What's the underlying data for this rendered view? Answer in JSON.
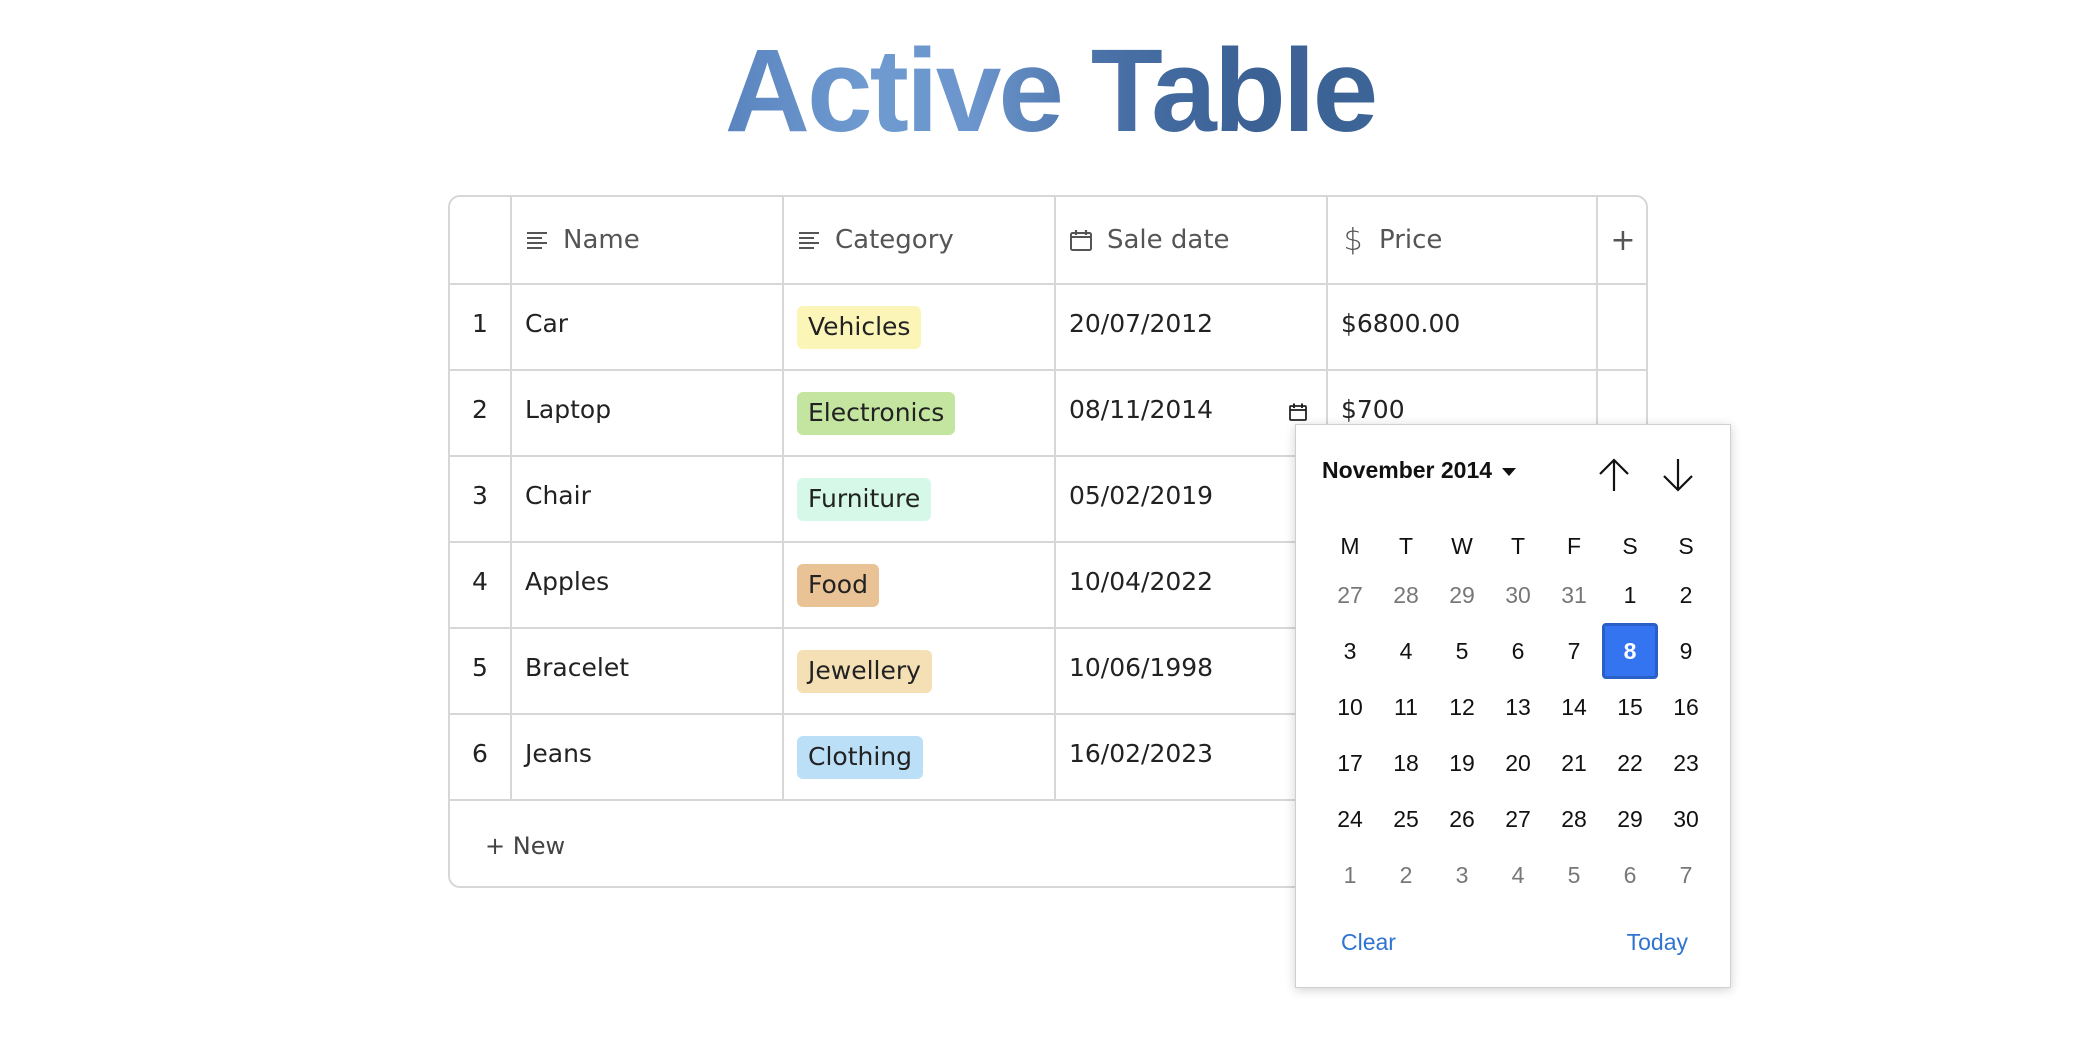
{
  "title": "Active Table",
  "table": {
    "columns": [
      {
        "label": "Name",
        "icon": "text-lines-icon"
      },
      {
        "label": "Category",
        "icon": "text-lines-icon"
      },
      {
        "label": "Sale date",
        "icon": "calendar-icon"
      },
      {
        "label": "Price",
        "icon": "dollar-icon"
      }
    ],
    "add_column_label": "+",
    "rows": [
      {
        "index": "1",
        "name": "Car",
        "category": "Vehicles",
        "category_color": "#fbf5b8",
        "sale_date": "20/07/2012",
        "price": "$6800.00"
      },
      {
        "index": "2",
        "name": "Laptop",
        "category": "Electronics",
        "category_color": "#c4e5a0",
        "sale_date": "08/11/2014",
        "price": "$700"
      },
      {
        "index": "3",
        "name": "Chair",
        "category": "Furniture",
        "category_color": "#d6f8e8",
        "sale_date": "05/02/2019",
        "price": ""
      },
      {
        "index": "4",
        "name": "Apples",
        "category": "Food",
        "category_color": "#e9c396",
        "sale_date": "10/04/2022",
        "price": ""
      },
      {
        "index": "5",
        "name": "Bracelet",
        "category": "Jewellery",
        "category_color": "#f4e0b4",
        "sale_date": "10/06/1998",
        "price": ""
      },
      {
        "index": "6",
        "name": "Jeans",
        "category": "Clothing",
        "category_color": "#bcdff8",
        "sale_date": "16/02/2023",
        "price": ""
      }
    ],
    "new_row_label": "+ New"
  },
  "datepicker": {
    "month_year": "November 2014",
    "prev_icon": "arrow-up-icon",
    "next_icon": "arrow-down-icon",
    "weekdays": [
      "M",
      "T",
      "W",
      "T",
      "F",
      "S",
      "S"
    ],
    "days": [
      {
        "d": "27",
        "other": true
      },
      {
        "d": "28",
        "other": true
      },
      {
        "d": "29",
        "other": true
      },
      {
        "d": "30",
        "other": true
      },
      {
        "d": "31",
        "other": true
      },
      {
        "d": "1"
      },
      {
        "d": "2"
      },
      {
        "d": "3"
      },
      {
        "d": "4"
      },
      {
        "d": "5"
      },
      {
        "d": "6"
      },
      {
        "d": "7"
      },
      {
        "d": "8",
        "selected": true
      },
      {
        "d": "9"
      },
      {
        "d": "10"
      },
      {
        "d": "11"
      },
      {
        "d": "12"
      },
      {
        "d": "13"
      },
      {
        "d": "14"
      },
      {
        "d": "15"
      },
      {
        "d": "16"
      },
      {
        "d": "17"
      },
      {
        "d": "18"
      },
      {
        "d": "19"
      },
      {
        "d": "20"
      },
      {
        "d": "21"
      },
      {
        "d": "22"
      },
      {
        "d": "23"
      },
      {
        "d": "24"
      },
      {
        "d": "25"
      },
      {
        "d": "26"
      },
      {
        "d": "27"
      },
      {
        "d": "28"
      },
      {
        "d": "29"
      },
      {
        "d": "30"
      },
      {
        "d": "1",
        "other": true
      },
      {
        "d": "2",
        "other": true
      },
      {
        "d": "3",
        "other": true
      },
      {
        "d": "4",
        "other": true
      },
      {
        "d": "5",
        "other": true
      },
      {
        "d": "6",
        "other": true
      },
      {
        "d": "7",
        "other": true
      }
    ],
    "selected_color": "#3574f0",
    "clear_label": "Clear",
    "today_label": "Today",
    "link_color": "#2f74d0"
  }
}
